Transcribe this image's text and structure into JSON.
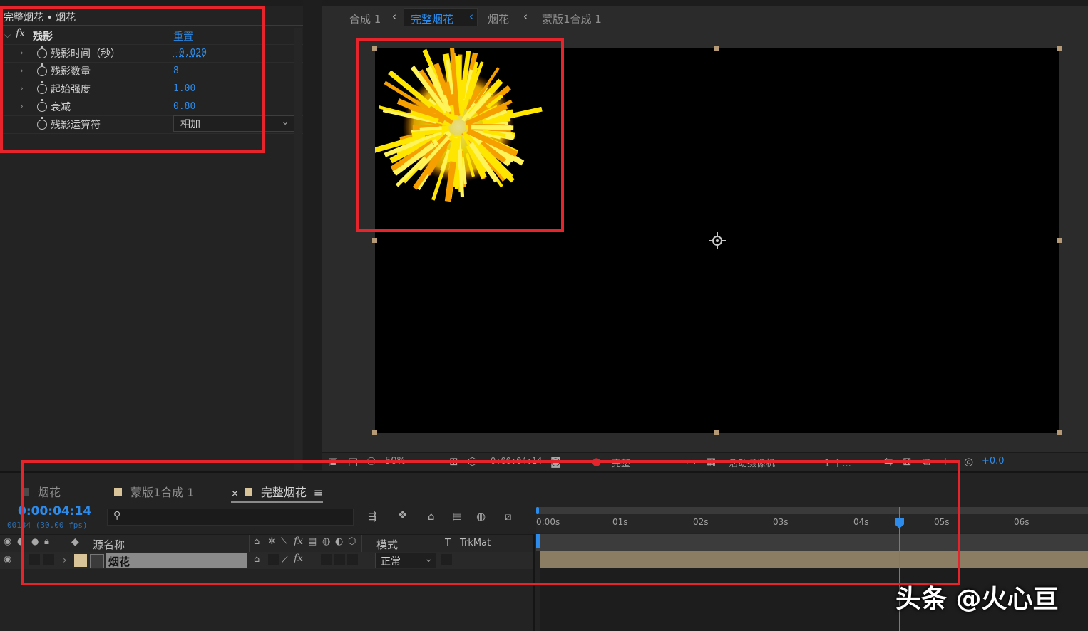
{
  "effect_controls": {
    "title": "完整烟花 • 烟花",
    "effect_name": "残影",
    "fx_label": "fx",
    "reset_label": "重置",
    "params": [
      {
        "label": "残影时间（秒）",
        "value": "-0.020"
      },
      {
        "label": "残影数量",
        "value": "8"
      },
      {
        "label": "起始强度",
        "value": "1.00"
      },
      {
        "label": "衰减",
        "value": "0.80"
      },
      {
        "label": "残影运算符",
        "value": "相加"
      }
    ]
  },
  "breadcrumbs": {
    "items": [
      "合成 1",
      "完整烟花",
      "烟花",
      "蒙版1合成 1"
    ],
    "active": "完整烟花"
  },
  "viewer_toolbar": {
    "zoom": "50%",
    "timecode": "0:00:04:14",
    "resolution": "完整",
    "camera": "活动摄像机",
    "views": "1 个...",
    "exposure": "+0.0"
  },
  "timeline": {
    "tabs": [
      "烟花",
      "蒙版1合成 1",
      "完整烟花"
    ],
    "active_tab": "完整烟花",
    "close_glyph": "×",
    "menu_glyph": "≡",
    "timecode": "0:00:04:14",
    "frame_info": "00134 (30.00 fps)",
    "search_placeholder": "",
    "column_headers": {
      "source_name": "源名称",
      "mode": "模式",
      "t": "T",
      "trkmat": "TrkMat"
    },
    "layer": {
      "name": "烟花",
      "mode": "正常"
    },
    "ruler_ticks": [
      "0:00s",
      "01s",
      "02s",
      "03s",
      "04s",
      "05s",
      "06s"
    ],
    "playhead_time": "04:14"
  },
  "watermark": "头条 @火心亘",
  "colors": {
    "accent": "#2d8ceb",
    "highlight_box": "#e6242b",
    "layer_bar": "#8a7d63",
    "firework": "#ffe600"
  }
}
